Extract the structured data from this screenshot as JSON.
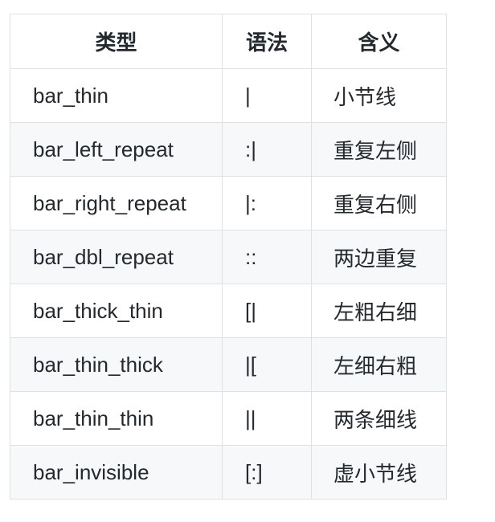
{
  "table": {
    "headers": [
      "类型",
      "语法",
      "含义"
    ],
    "rows": [
      {
        "type": "bar_thin",
        "syntax": "|",
        "meaning": "小节线"
      },
      {
        "type": "bar_left_repeat",
        "syntax": ":|",
        "meaning": "重复左侧"
      },
      {
        "type": "bar_right_repeat",
        "syntax": "|:",
        "meaning": "重复右侧"
      },
      {
        "type": "bar_dbl_repeat",
        "syntax": "::",
        "meaning": "两边重复"
      },
      {
        "type": "bar_thick_thin",
        "syntax": "[|",
        "meaning": "左粗右细"
      },
      {
        "type": "bar_thin_thick",
        "syntax": "|[",
        "meaning": "左细右粗"
      },
      {
        "type": "bar_thin_thin",
        "syntax": "||",
        "meaning": "两条细线"
      },
      {
        "type": "bar_invisible",
        "syntax": "[:]",
        "meaning": "虚小节线"
      }
    ]
  }
}
